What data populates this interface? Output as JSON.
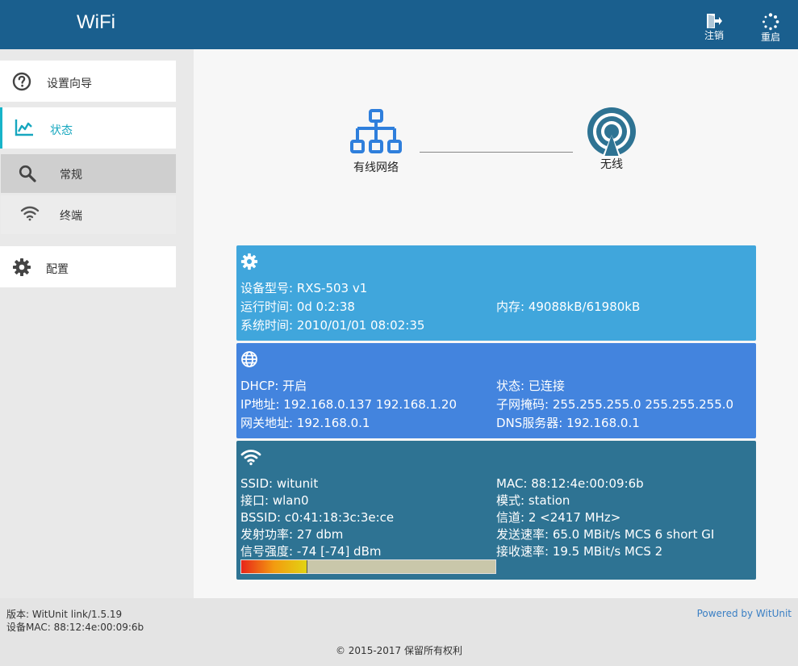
{
  "header": {
    "brand": "WiFi",
    "logout_label": "注销",
    "reboot_label": "重启"
  },
  "sidebar": {
    "items": [
      {
        "label": "设置向导",
        "icon": "question-circle-icon"
      },
      {
        "label": "状态",
        "icon": "line-chart-icon",
        "active": true
      },
      {
        "label": "常规",
        "icon": "search-icon",
        "selected": true
      },
      {
        "label": "终端",
        "icon": "wifi-icon"
      },
      {
        "label": "配置",
        "icon": "gear-icon"
      }
    ]
  },
  "topology": {
    "wired_label": "有线网络",
    "wireless_label": "无线"
  },
  "system": {
    "model": "设备型号: RXS-503 v1",
    "uptime": "运行时间: 0d 0:2:38",
    "memory": "内存: 49088kB/61980kB",
    "systime": "系统时间: 2010/01/01 08:02:35"
  },
  "network": {
    "dhcp": "DHCP: 开启",
    "state": "状态: 已连接",
    "ip": "IP地址: 192.168.0.137 192.168.1.20",
    "netmask": "子网掩码: 255.255.255.0 255.255.255.0",
    "gateway": "网关地址: 192.168.0.1",
    "dns": "DNS服务器: 192.168.0.1"
  },
  "wireless": {
    "ssid": "SSID: witunit",
    "mac": "MAC: 88:12:4e:00:09:6b",
    "iface": "接口: wlan0",
    "mode": "模式: station",
    "bssid": "BSSID: c0:41:18:3c:3e:ce",
    "channel": "信道: 2 <2417 MHz>",
    "txpower": "发射功率: 27 dbm",
    "txrate": "发送速率: 65.0 MBit/s MCS 6 short GI",
    "signal": "信号强度: -74 [-74] dBm",
    "rxrate": "接收速率: 19.5 MBit/s MCS 2",
    "signal_level": 0.26
  },
  "footer": {
    "version": "版本: WitUnit link/1.5.19",
    "device_mac": "设备MAC: 88:12:4e:00:09:6b",
    "powered_by": "Powered by WitUnit",
    "copyright": "© 2015-2017  保留所有权利"
  },
  "colors": {
    "header": "#1a5f8e",
    "accent": "#17b4c9",
    "panel_system": "#40a6dc",
    "panel_network": "#4384de",
    "panel_wireless": "#2e7393"
  }
}
